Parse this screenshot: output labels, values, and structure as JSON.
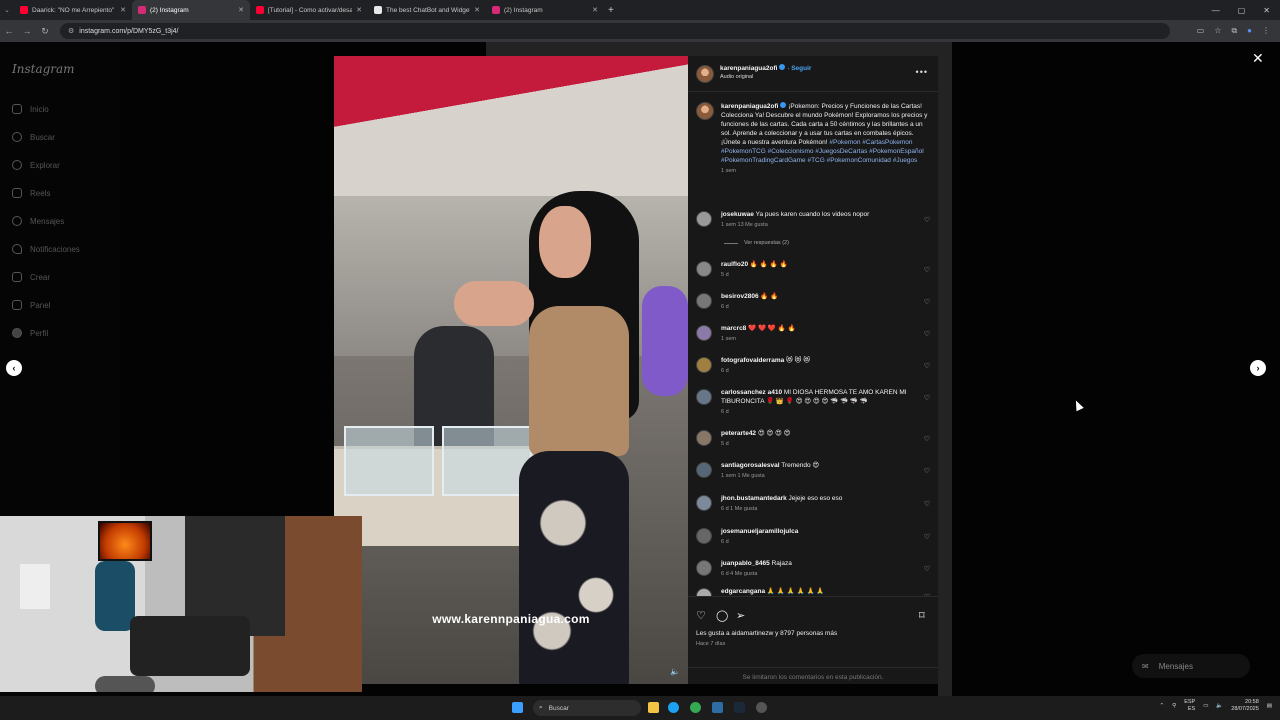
{
  "browser": {
    "tabs": [
      {
        "title": "Daarick: \"NO me Arrepiento\"",
        "color": "#ff0033",
        "active": false
      },
      {
        "title": "(2) Instagram",
        "color": "#d62976",
        "active": true
      },
      {
        "title": "[Tutorial] - Como activar/desac",
        "color": "#ff0033",
        "active": false
      },
      {
        "title": "The best ChatBot and Widget",
        "color": "#e8e8e8",
        "active": false
      },
      {
        "title": "(2) Instagram",
        "color": "#d62976",
        "active": false
      }
    ],
    "url": "instagram.com/p/DMY5zG_t3j4/"
  },
  "sidebar": {
    "logo": "Instagram",
    "items": [
      {
        "label": "Inicio",
        "icon": "home-icon"
      },
      {
        "label": "Buscar",
        "icon": "search-icon"
      },
      {
        "label": "Explorar",
        "icon": "compass-icon"
      },
      {
        "label": "Reels",
        "icon": "reels-icon"
      },
      {
        "label": "Mensajes",
        "icon": "messages-icon"
      },
      {
        "label": "Notificaciones",
        "icon": "heart-icon"
      },
      {
        "label": "Crear",
        "icon": "plus-icon"
      },
      {
        "label": "Panel",
        "icon": "dashboard-icon"
      },
      {
        "label": "Perfil",
        "icon": "avatar-icon"
      }
    ]
  },
  "video": {
    "watermark": "www.karennpaniagua.com"
  },
  "post": {
    "username": "karenpaniagua2ofi",
    "follow": "Seguir",
    "audio": "Audio original",
    "caption_text": "¡Pokemon: Precios y Funciones de las Cartas! Colecciona Ya! Descubre el mundo Pokémon! Exploramos los precios y funciones de las cartas. Cada carta a 50 céntimos y las brillantes a un sol. Aprende a coleccionar y a usar tus cartas en combates épicos. ¡Únete a nuestra aventura Pokémon!",
    "hashtags": "#Pokemon #CartasPokemon #PokemonTCG #Coleccionismo #JuegosDeCartas #PokemonEspañol #PokemonTradingCardGame #TCG #PokemonComunidad #Juegos",
    "caption_time": "1 sem",
    "view_replies": "Ver respuestas (2)",
    "comments": [
      {
        "user": "josekuwae",
        "text": "Ya pues karen cuando los videos nopor",
        "meta": "1 sem   13 Me gusta"
      },
      {
        "user": "raulflo20",
        "text": "🔥 🔥 🔥 🔥",
        "meta": "5 d"
      },
      {
        "user": "besirov2806",
        "text": "🔥 🔥",
        "meta": "6 d"
      },
      {
        "user": "marcrc8",
        "text": "❤️ ❤️ ❤️ 🔥 🔥",
        "meta": "1 sem"
      },
      {
        "user": "fotografovalderrama",
        "text": "😻 😻 😻",
        "meta": "6 d"
      },
      {
        "user": "carlossanchez a410",
        "text": "MI DIOSA HERMOSA TE AMO KAREN MI TIBURONCITA 🌹 👑 🌹 😍 😍 😍 😍 🦈 🦈 🦈 🦈",
        "meta": "6 d"
      },
      {
        "user": "peterarte42",
        "text": "😍 😍 😍 😍",
        "meta": "5 d"
      },
      {
        "user": "santiagorosalesval",
        "text": "Tremendo 😍",
        "meta": "1 sem   1 Me gusta"
      },
      {
        "user": "jhon.bustamantedark",
        "text": "Jejeje eso eso eso",
        "meta": "6 d   1 Me gusta"
      },
      {
        "user": "josemanueljaramillojulca",
        "text": "",
        "meta": "6 d"
      },
      {
        "user": "juanpablo_8465",
        "text": "Rajaza",
        "meta": "6 d   4 Me gusta"
      },
      {
        "user": "edgarcangana",
        "text": "🙏 🙏 🙏 🙏 🙏 🙏",
        "meta": ""
      }
    ],
    "likes_text": "Les gusta a aidamartinezw y 8797 personas más",
    "date": "Hace 7 días",
    "limited": "Se limitaron los comentarios en esta publicación."
  },
  "messages_button": "Mensajes",
  "taskbar": {
    "search": "Buscar",
    "lang": "ESP",
    "lang2": "ES",
    "time": "20:58",
    "date": "28/07/2025"
  }
}
